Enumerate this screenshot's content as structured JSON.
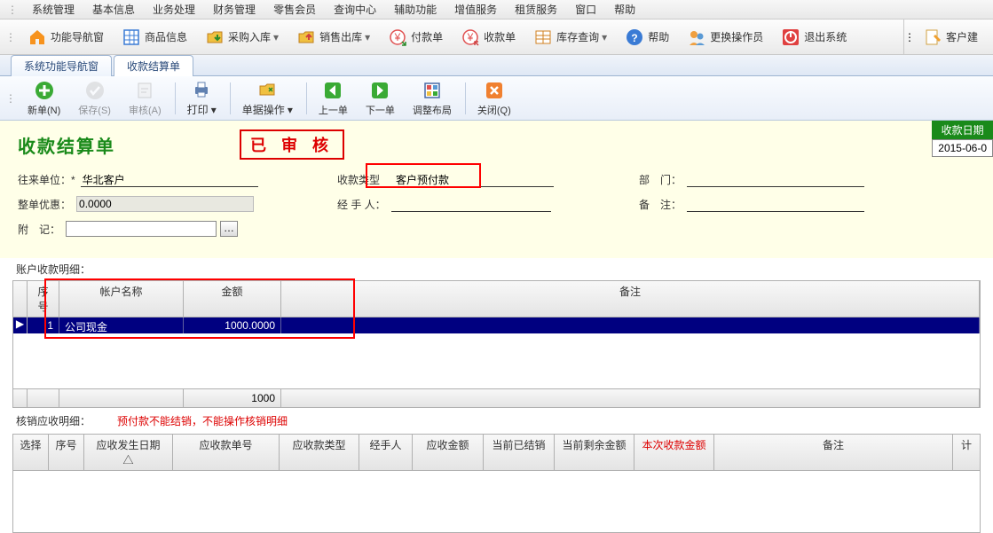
{
  "menu": [
    "系统管理",
    "基本信息",
    "业务处理",
    "财务管理",
    "零售会员",
    "查询中心",
    "辅助功能",
    "增值服务",
    "租赁服务",
    "窗口",
    "帮助"
  ],
  "toolbar": [
    {
      "label": "功能导航窗",
      "icon": "home",
      "color": "#f7931e"
    },
    {
      "label": "商品信息",
      "icon": "grid",
      "color": "#3a7bd5"
    },
    {
      "label": "采购入库",
      "icon": "folder",
      "color": "#f0a030"
    },
    {
      "label": "销售出库",
      "icon": "folder-out",
      "color": "#f0a030"
    },
    {
      "label": "付款单",
      "icon": "money-out",
      "color": "#e05050"
    },
    {
      "label": "收款单",
      "icon": "money-in",
      "color": "#e05050"
    },
    {
      "label": "库存查询",
      "icon": "table",
      "color": "#d08020"
    },
    {
      "label": "帮助",
      "icon": "help",
      "color": "#3a7bd5"
    },
    {
      "label": "更换操作员",
      "icon": "users",
      "color": "#3a7bd5"
    },
    {
      "label": "退出系统",
      "icon": "power",
      "color": "#e04040"
    }
  ],
  "toolbar_right": {
    "label": "客户建",
    "icon": "edit",
    "color": "#f0a030"
  },
  "tabs": [
    {
      "label": "系统功能导航窗",
      "active": false
    },
    {
      "label": "收款结算单",
      "active": true
    }
  ],
  "actions": [
    {
      "label": "新单(N)",
      "icon": "plus",
      "color": "#3aaa35",
      "enabled": true
    },
    {
      "label": "保存(S)",
      "icon": "check",
      "color": "#999",
      "enabled": false
    },
    {
      "label": "审核(A)",
      "icon": "stamp",
      "color": "#999",
      "enabled": false
    },
    {
      "sep": true
    },
    {
      "label": "打印",
      "icon": "print",
      "color": "#4a6aa5",
      "enabled": true,
      "dd": true
    },
    {
      "sep": true
    },
    {
      "label": "单据操作",
      "icon": "ops",
      "color": "#f0a030",
      "enabled": true,
      "dd": true
    },
    {
      "sep": true
    },
    {
      "label": "上一单",
      "icon": "prev",
      "color": "#3aaa35",
      "enabled": true
    },
    {
      "label": "下一单",
      "icon": "next",
      "color": "#3aaa35",
      "enabled": true
    },
    {
      "label": "调整布局",
      "icon": "layout",
      "color": "#4a6aa5",
      "enabled": true
    },
    {
      "sep": true
    },
    {
      "label": "关闭(Q)",
      "icon": "close",
      "color": "#f08030",
      "enabled": true
    }
  ],
  "doc": {
    "title": "收款结算单",
    "stamp": "已 审 核",
    "date_label": "收款日期",
    "date_value": "2015-06-0",
    "unit_label": "往来单位：*",
    "unit_value": "华北客户",
    "type_label": "收款类型",
    "type_value": "客户预付款",
    "dept_label": "部　门：",
    "dept_value": "",
    "discount_label": "整单优惠：",
    "discount_value": "0.0000",
    "handler_label": "经 手 人：",
    "handler_value": "",
    "remark_label": "备　注：",
    "remark_value": "",
    "attach_label": "附　记：",
    "attach_value": ""
  },
  "grid1": {
    "section_label": "账户收款明细：",
    "headers": [
      "序号",
      "帐户名称",
      "金额",
      "备注"
    ],
    "row": {
      "seq": "1",
      "name": "公司现金",
      "amount": "1000.0000",
      "remark": ""
    },
    "footer_amount": "1000"
  },
  "note": {
    "label": "核销应收明细：",
    "text": "预付款不能结销，不能操作核销明细"
  },
  "grid2": {
    "headers": [
      "选择",
      "序号",
      "应收发生日期",
      "应收款单号",
      "应收款类型",
      "经手人",
      "应收金额",
      "当前已结销",
      "当前剩余金额",
      "本次收款金额",
      "备注",
      "计"
    ],
    "red_index": 9
  }
}
